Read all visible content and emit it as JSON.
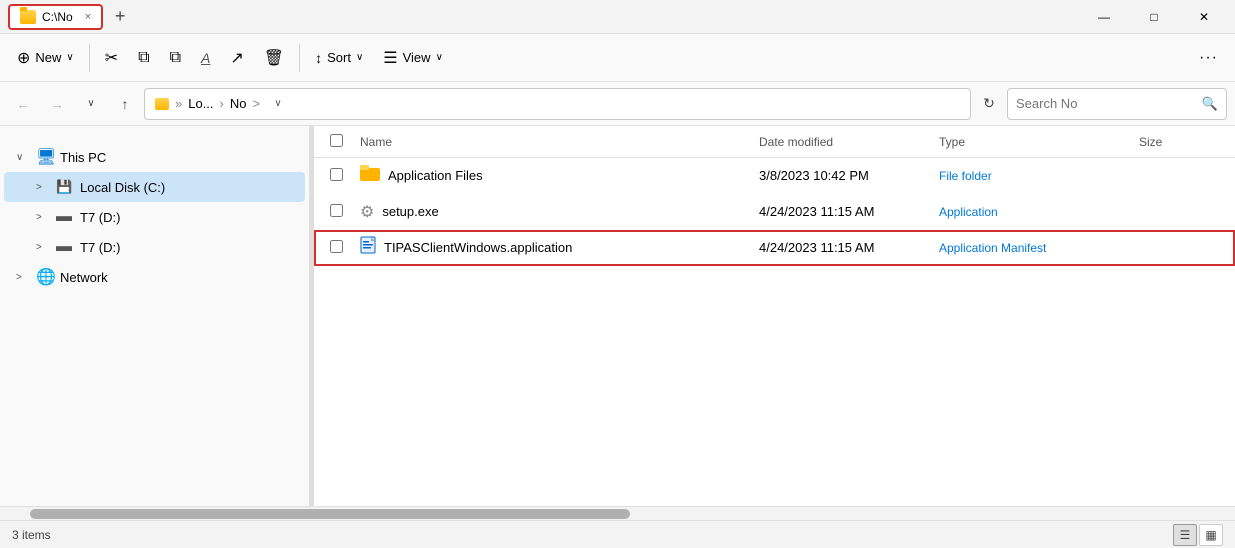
{
  "titlebar": {
    "tab_label": "C:\\No",
    "close_tab": "×",
    "new_tab": "+",
    "minimize": "—",
    "maximize": "□",
    "close": "✕"
  },
  "toolbar": {
    "new_label": "New",
    "new_chevron": "∨",
    "cut_icon": "✂",
    "copy_icon": "⧉",
    "paste_icon": "📋",
    "rename_icon": "A",
    "share_icon": "↗",
    "delete_icon": "🗑",
    "sort_label": "Sort",
    "sort_chevron": "∨",
    "view_label": "View",
    "view_chevron": "∨",
    "more_icon": "···"
  },
  "navbar": {
    "back_icon": "←",
    "forward_icon": "→",
    "recent_icon": "∨",
    "up_icon": "↑",
    "breadcrumb_pre": "Lo...",
    "breadcrumb_sep1": "»",
    "breadcrumb_folder": "No",
    "breadcrumb_sep2": ">",
    "chevron_down": "∨",
    "refresh_icon": "↻",
    "search_placeholder": "Search No",
    "search_icon": "🔍"
  },
  "sidebar": {
    "items": [
      {
        "label": "This PC",
        "icon": "🖥",
        "expander": "∨",
        "has_expander": true,
        "indent": 0,
        "active": false
      },
      {
        "label": "Local Disk (C:)",
        "icon": "💾",
        "expander": ">",
        "has_expander": true,
        "indent": 1,
        "active": true
      },
      {
        "label": "T7 (D:)",
        "icon": "▬",
        "expander": ">",
        "has_expander": true,
        "indent": 1,
        "active": false
      },
      {
        "label": "T7 (D:)",
        "icon": "▬",
        "expander": ">",
        "has_expander": true,
        "indent": 1,
        "active": false
      },
      {
        "label": "Network",
        "icon": "🌐",
        "expander": ">",
        "has_expander": true,
        "indent": 0,
        "active": false
      }
    ]
  },
  "fileheader": {
    "col_name": "Name",
    "col_date": "Date modified",
    "col_type": "Type",
    "col_size": "Size"
  },
  "files": [
    {
      "name": "Application Files",
      "icon": "📁",
      "icon_color": "folder",
      "date": "3/8/2023 10:42 PM",
      "type": "File folder",
      "size": "",
      "selected": false,
      "highlighted": false
    },
    {
      "name": "setup.exe",
      "icon": "⚙",
      "icon_color": "setup",
      "date": "4/24/2023 11:15 AM",
      "type": "Application",
      "size": "",
      "selected": false,
      "highlighted": false
    },
    {
      "name": "TIPASClientWindows.application",
      "icon": "📄",
      "icon_color": "manifest",
      "date": "4/24/2023 11:15 AM",
      "type": "Application Manifest",
      "size": "",
      "selected": false,
      "highlighted": true
    }
  ],
  "statusbar": {
    "items_count": "3 items",
    "view_list_icon": "☰",
    "view_grid_icon": "▦"
  }
}
